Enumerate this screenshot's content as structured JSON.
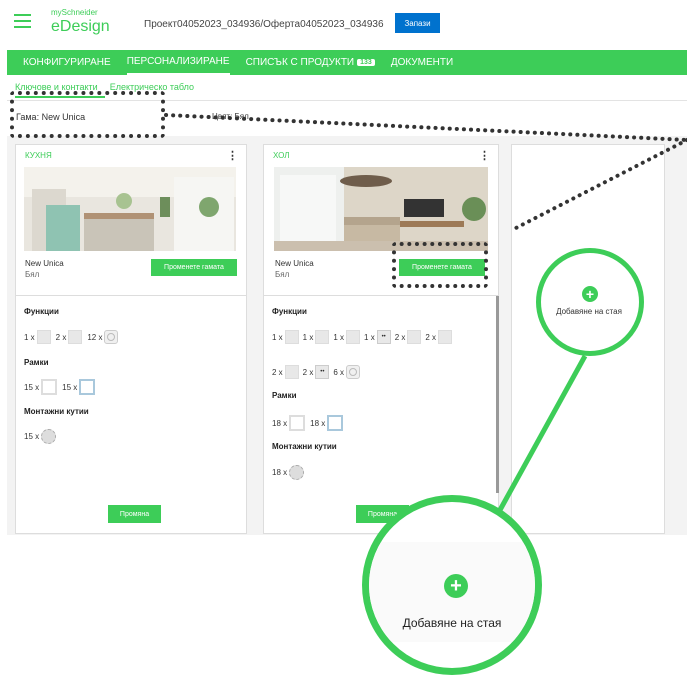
{
  "header": {
    "brand_small": "mySchneider",
    "brand": "eDesign",
    "project": "Проект04052023_034936/Оферта04052023_034936",
    "save_label": "Запази"
  },
  "nav": {
    "tabs": [
      {
        "label": "КОНФИГУРИРАНЕ"
      },
      {
        "label": "ПЕРСОНАЛИЗИРАНЕ"
      },
      {
        "label": "СПИСЪК С ПРОДУКТИ"
      },
      {
        "label": "ДОКУМЕНТИ"
      }
    ],
    "products_count": "133"
  },
  "subtabs": [
    "Ключове и контакти",
    "Електрическо табло"
  ],
  "filters": {
    "gama": "Гама: New Unica",
    "color": "Цвят: Бял"
  },
  "rooms": [
    {
      "name": "КУХНЯ",
      "range": "New Unica",
      "color": "Бял",
      "change_range": "Променете гамата",
      "functions_title": "Функции",
      "functions": [
        "1 x",
        "2 x",
        "12 x"
      ],
      "frames_title": "Рамки",
      "frames": [
        "15 x",
        "15 x"
      ],
      "boxes_title": "Монтажни кутии",
      "boxes": [
        "15 x"
      ],
      "change_button": "Промяна"
    },
    {
      "name": "ХОЛ",
      "range": "New Unica",
      "color": "Бял",
      "change_range": "Променете гамата",
      "functions_title": "Функции",
      "functions_row1": [
        "1 x",
        "1 x",
        "1 x",
        "1 x",
        "2 x",
        "2 x"
      ],
      "functions_row2": [
        "2 x",
        "2 x",
        "6 x"
      ],
      "frames_title": "Рамки",
      "frames": [
        "18 x",
        "18 x"
      ],
      "boxes_title": "Монтажни кутии",
      "boxes": [
        "18 x"
      ],
      "change_button": "Промяна"
    }
  ],
  "add_room": {
    "label": "Добавяне на стая",
    "plus": "+"
  },
  "icons": [
    "hamburger-icon",
    "more-vert-icon",
    "plus-icon"
  ],
  "colors": {
    "brand_green": "#3dcd58",
    "save_blue": "#0072ce"
  }
}
